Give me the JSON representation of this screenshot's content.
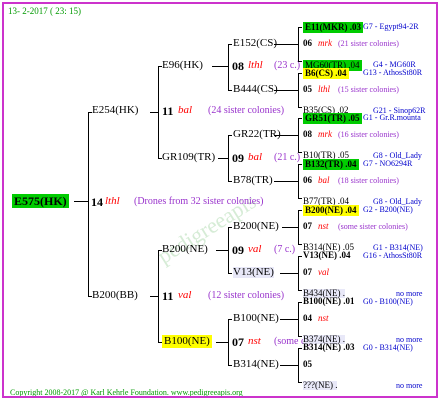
{
  "header": {
    "date": "13-  2-2017 ( 23: 15)"
  },
  "footer": {
    "copyright": "Copyright 2008-2017 @ Karl Kehrle Foundation.   www.pedigreeapis.org"
  },
  "watermark": "pedigreeapis",
  "root": {
    "id": "E575(HK)",
    "num": "14",
    "breed": "lthl",
    "note": "(Drones from 32 sister colonies)"
  },
  "gen1": {
    "top": {
      "id": "E254(HK)",
      "num": "11",
      "breed": "bal",
      "note": "(24 sister colonies)"
    },
    "bottom": {
      "id": "B200(BB)",
      "num": "11",
      "breed": "val",
      "note": "(12 sister colonies)"
    }
  },
  "gen2": {
    "e96": {
      "id": "E96(HK)",
      "num": "08",
      "breed": "lthl",
      "note": "(23 c.)"
    },
    "gr109": {
      "id": "GR109(TR)",
      "num": "09",
      "breed": "bal",
      "note": "(21 c.)"
    },
    "b200ne": {
      "id": "B200(NE)",
      "num": "09",
      "breed": "val",
      "note": "(7 c.)"
    },
    "b100ne": {
      "id": "B100(NE)",
      "num": "07",
      "breed": "nst",
      "note": "(some c.)"
    }
  },
  "gen3": {
    "e152": {
      "id": "E152(CS)"
    },
    "b444": {
      "id": "B444(CS)"
    },
    "gr22": {
      "id": "GR22(TR)"
    },
    "b78": {
      "id": "B78(TR)"
    },
    "b200": {
      "id": "B200(NE)"
    },
    "v13": {
      "id": "V13(NE)"
    },
    "b100": {
      "id": "B100(NE)"
    },
    "b314": {
      "id": "B314(NE)"
    }
  },
  "gen4": [
    {
      "top": "E11(MKR) .03",
      "topRight": "G7 - Egypt94-2R",
      "mid": "06",
      "midBreed": "mrk",
      "midNote": "(21 sister colonies)",
      "bot": "MG60(TR) .04",
      "botRight": "G4 - MG60R"
    },
    {
      "top": "B6(CS) .04",
      "topRight": "G13 - AthosSt80R",
      "mid": "05",
      "midBreed": "lthl",
      "midNote": "(15 sister colonies)",
      "bot": "B35(CS) .02",
      "botRight": "G21 - Sinop62R"
    },
    {
      "top": "GR51(TR) .05",
      "topRight": "G1 - Gr.R.mounta",
      "mid": "08",
      "midBreed": "mrk",
      "midNote": "(16 sister colonies)",
      "bot": "B10(TR) .05",
      "botRight": "G8 - Old_Lady"
    },
    {
      "top": "B132(TR) .04",
      "topRight": "G7 - NO6294R",
      "mid": "06",
      "midBreed": "bal",
      "midNote": "(18 sister colonies)",
      "bot": "B77(TR) .04",
      "botRight": "G8 - Old_Lady"
    },
    {
      "top": "B200(NE) .04",
      "topRight": "G2 - B200(NE)",
      "mid": "07",
      "midBreed": "nst",
      "midNote": "(some sister colonies)",
      "bot": "B314(NE) .05",
      "botRight": "G1 - B314(NE)"
    },
    {
      "top": "V13(NE) .04",
      "topRight": "G16 - AthosSt80R",
      "mid": "07",
      "midBreed": "val",
      "midNote": "",
      "bot": "B434(NE) .",
      "botRight": "no more"
    },
    {
      "top": "B100(NE) .01",
      "topRight": "G0 - B100(NE)",
      "mid": "04",
      "midBreed": "nst",
      "midNote": "",
      "bot": "B374(NE) .",
      "botRight": "no more"
    },
    {
      "top": "B314(NE) .03",
      "topRight": "G0 - B314(NE)",
      "mid": "05",
      "midBreed": "",
      "midNote": "",
      "bot": "???(NE) .",
      "botRight": "no more"
    }
  ]
}
